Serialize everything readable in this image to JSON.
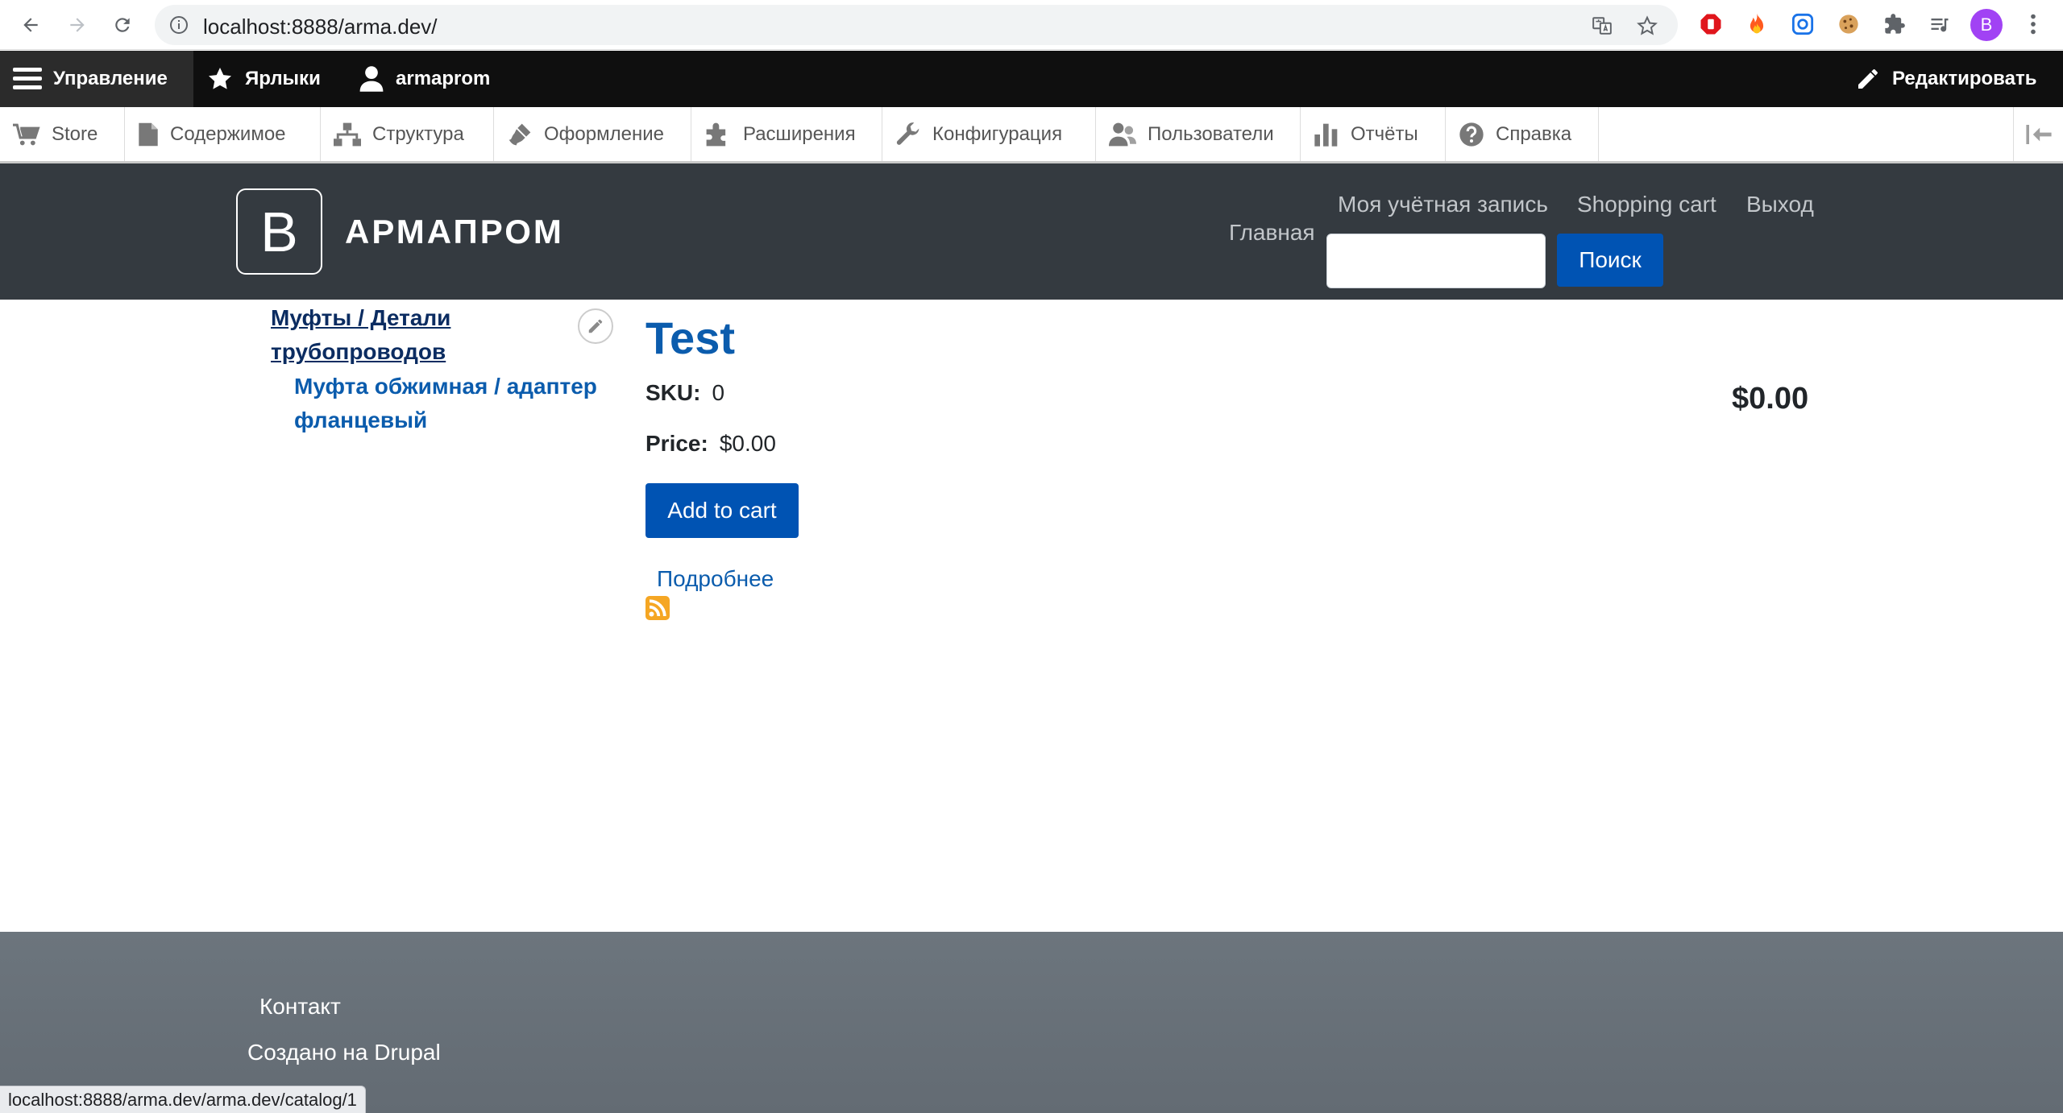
{
  "browser": {
    "url": "localhost:8888/arma.dev/",
    "profile_initial": "B",
    "status_url": "localhost:8888/arma.dev/arma.dev/catalog/1"
  },
  "toolbar": {
    "manage_label": "Управление",
    "shortcuts_label": "Ярлыки",
    "user_label": "armaprom",
    "edit_label": "Редактировать",
    "tray": [
      {
        "label": "Store",
        "icon": "cart-icon"
      },
      {
        "label": "Содержимое",
        "icon": "document-icon"
      },
      {
        "label": "Структура",
        "icon": "sitemap-icon"
      },
      {
        "label": "Оформление",
        "icon": "paintbrush-icon"
      },
      {
        "label": "Расширения",
        "icon": "puzzle-icon"
      },
      {
        "label": "Конфигурация",
        "icon": "wrench-icon"
      },
      {
        "label": "Пользователи",
        "icon": "users-icon"
      },
      {
        "label": "Отчёты",
        "icon": "bar-chart-icon"
      },
      {
        "label": "Справка",
        "icon": "help-icon"
      }
    ]
  },
  "header": {
    "logo_letter": "B",
    "site_name": "АРМАПРОМ",
    "main_nav": "Главная",
    "account_nav": [
      "Моя учётная запись",
      "Shopping cart",
      "Выход"
    ],
    "search_button": "Поиск",
    "search_value": ""
  },
  "sidebar": {
    "parent": "Муфты / Детали трубопроводов",
    "child": "Муфта обжимная / адаптер фланцевый"
  },
  "product": {
    "title": "Test",
    "sku_label": "SKU:",
    "sku_value": "0",
    "price_label": "Price:",
    "price_value": "$0.00",
    "add_to_cart": "Add to cart",
    "more_link": "Подробнее",
    "display_price": "$0.00"
  },
  "footer": {
    "contact": "Контакт",
    "powered": "Создано на Drupal"
  },
  "colors": {
    "accent": "#0053b3",
    "header_bg": "#343a40",
    "footer_bg": "#6c757d",
    "toolbar_bg": "#0f0f0f"
  }
}
